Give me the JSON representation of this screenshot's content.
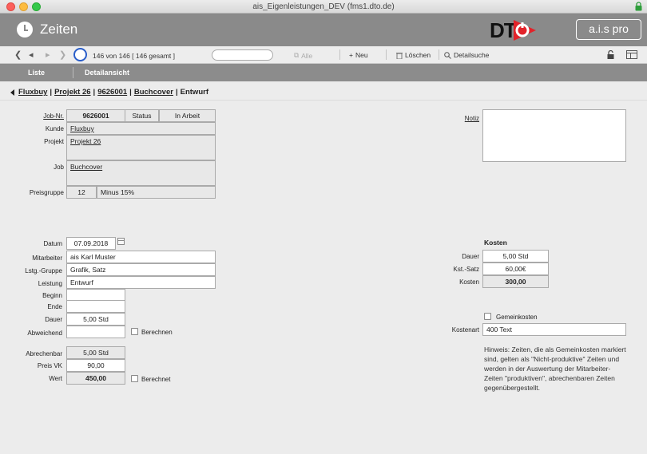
{
  "window": {
    "title": "ais_Eigenleistungen_DEV (fms1.dto.de)"
  },
  "header": {
    "title": "Zeiten",
    "logo_text": "DT",
    "brand": "a.i.s pro"
  },
  "toolbar": {
    "record_info": "146 von 146  [ 146 gesamt ]",
    "all_label": "Alle",
    "new_label": "Neu",
    "delete_label": "Löschen",
    "detail_search_label": "Detailsuche"
  },
  "tabs": [
    {
      "label": "Liste"
    },
    {
      "label": "Detailansicht"
    }
  ],
  "breadcrumb": {
    "customer": "Fluxbuy",
    "project": "Projekt 26",
    "job_no": "9626001",
    "job": "Buchcover",
    "status": "Entwurf"
  },
  "job": {
    "job_no_label": "Job-Nr.",
    "job_no": "9626001",
    "status_label": "Status",
    "status": "In Arbeit",
    "customer_label": "Kunde",
    "customer": "Fluxbuy",
    "project_label": "Projekt",
    "project": "Projekt 26",
    "job_label": "Job",
    "job": "Buchcover",
    "price_group_label": "Preisgruppe",
    "price_group_no": "12",
    "price_group": "Minus 15%"
  },
  "note": {
    "label": "Notiz",
    "value": ""
  },
  "time": {
    "date_label": "Datum",
    "date": "07.09.2018",
    "employee_label": "Mitarbeiter",
    "employee": "ais Karl Muster",
    "service_group_label": "Lstg.-Gruppe",
    "service_group": "Grafik, Satz",
    "service_label": "Leistung",
    "service": "Entwurf",
    "begin_label": "Beginn",
    "begin": "",
    "end_label": "Ende",
    "end": "",
    "duration_label": "Dauer",
    "duration": "5,00 Std",
    "deviating_label": "Abweichend",
    "deviating": "",
    "calculate_label": "Berechnen",
    "billable_label": "Abrechenbar",
    "billable": "5,00 Std",
    "price_label": "Preis VK",
    "price": "90,00",
    "value_label": "Wert",
    "value": "450,00",
    "charged_label": "Berechnet"
  },
  "costs": {
    "title": "Kosten",
    "duration_label": "Dauer",
    "duration": "5,00 Std",
    "rate_label": "Kst.-Satz",
    "rate": "60,00€",
    "costs_label": "Kosten",
    "costs": "300,00",
    "overhead_label": "Gemeinkosten",
    "cost_type_label": "Kostenart",
    "cost_type": "400 Text",
    "hint": "Hinweis: Zeiten, die als Gemeinkosten markiert sind, gelten als \"Nicht-produktive\" Zeiten und werden in der Auswertung der Mitarbeiter-Zeiten \"produktiven\", abrechenbaren  Zeiten gegenübergestellt."
  },
  "colors": {
    "header_bg": "#8a8a8a",
    "record_circle": "#2a5ec9",
    "logo_red": "#e2232a"
  }
}
